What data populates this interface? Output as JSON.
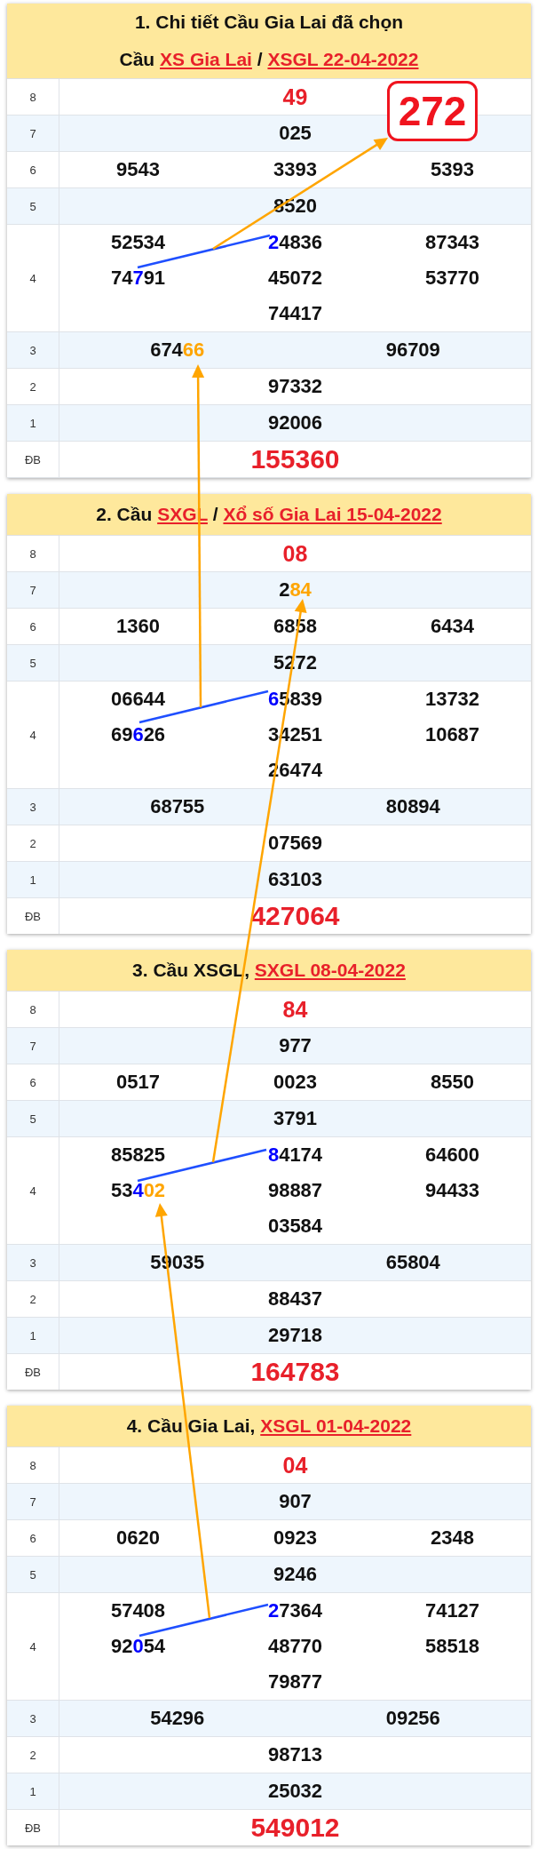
{
  "cards": [
    {
      "title_lines": [
        [
          {
            "text": "1. Chi tiết Cầu Gia Lai đã chọn"
          }
        ],
        [
          {
            "text": "Cầu "
          },
          {
            "text": "XS Gia Lai",
            "link": true
          },
          {
            "text": " / "
          },
          {
            "text": "XSGL 22-04-2022",
            "link": true
          }
        ]
      ],
      "badge": "272",
      "rows": [
        {
          "label": "8",
          "kind": "eighth",
          "values": [
            [
              {
                "text": "49"
              }
            ]
          ]
        },
        {
          "label": "7",
          "kind": "regular",
          "values": [
            [
              {
                "text": "025"
              }
            ]
          ]
        },
        {
          "label": "6",
          "kind": "regular",
          "values": [
            [
              {
                "text": "9543"
              }
            ],
            [
              {
                "text": "3393"
              }
            ],
            [
              {
                "text": "5393"
              }
            ]
          ]
        },
        {
          "label": "5",
          "kind": "regular",
          "values": [
            [
              {
                "text": "8520"
              }
            ]
          ]
        },
        {
          "label": "4",
          "kind": "regular",
          "values": [
            [
              {
                "text": "52534"
              }
            ],
            [
              {
                "text": "2",
                "color": "#0000ff"
              },
              {
                "text": "4836"
              }
            ],
            [
              {
                "text": "87343"
              }
            ],
            [
              {
                "text": "74"
              },
              {
                "text": "7",
                "color": "#0000ff"
              },
              {
                "text": "91"
              }
            ],
            [
              {
                "text": "45072"
              }
            ],
            [
              {
                "text": "53770"
              }
            ],
            [
              {
                "text": "74417"
              }
            ]
          ]
        },
        {
          "label": "3",
          "kind": "regular",
          "values": [
            [
              {
                "text": "674"
              },
              {
                "text": "66",
                "color": "#ffa500"
              }
            ],
            [
              {
                "text": "96709"
              }
            ]
          ]
        },
        {
          "label": "2",
          "kind": "regular",
          "values": [
            [
              {
                "text": "97332"
              }
            ]
          ]
        },
        {
          "label": "1",
          "kind": "regular",
          "values": [
            [
              {
                "text": "92006"
              }
            ]
          ]
        },
        {
          "label": "ĐB",
          "kind": "special",
          "values": [
            [
              {
                "text": "155360"
              }
            ]
          ]
        }
      ]
    },
    {
      "title_lines": [
        [
          {
            "text": "2. Cầu "
          },
          {
            "text": "SXGL",
            "link": true
          },
          {
            "text": " / "
          },
          {
            "text": "Xổ số Gia Lai 15-04-2022",
            "link": true
          }
        ]
      ],
      "rows": [
        {
          "label": "8",
          "kind": "eighth",
          "values": [
            [
              {
                "text": "08"
              }
            ]
          ]
        },
        {
          "label": "7",
          "kind": "regular",
          "values": [
            [
              {
                "text": "2"
              },
              {
                "text": "84",
                "color": "#ffa500"
              }
            ]
          ]
        },
        {
          "label": "6",
          "kind": "regular",
          "values": [
            [
              {
                "text": "1360"
              }
            ],
            [
              {
                "text": "6858"
              }
            ],
            [
              {
                "text": "6434"
              }
            ]
          ]
        },
        {
          "label": "5",
          "kind": "regular",
          "values": [
            [
              {
                "text": "5272"
              }
            ]
          ]
        },
        {
          "label": "4",
          "kind": "regular",
          "values": [
            [
              {
                "text": "06644"
              }
            ],
            [
              {
                "text": "6",
                "color": "#0000ff"
              },
              {
                "text": "5839"
              }
            ],
            [
              {
                "text": "13732"
              }
            ],
            [
              {
                "text": "69"
              },
              {
                "text": "6",
                "color": "#0000ff"
              },
              {
                "text": "26"
              }
            ],
            [
              {
                "text": "34251"
              }
            ],
            [
              {
                "text": "10687"
              }
            ],
            [
              {
                "text": "26474"
              }
            ]
          ]
        },
        {
          "label": "3",
          "kind": "regular",
          "values": [
            [
              {
                "text": "68755"
              }
            ],
            [
              {
                "text": "80894"
              }
            ]
          ]
        },
        {
          "label": "2",
          "kind": "regular",
          "values": [
            [
              {
                "text": "07569"
              }
            ]
          ]
        },
        {
          "label": "1",
          "kind": "regular",
          "values": [
            [
              {
                "text": "63103"
              }
            ]
          ]
        },
        {
          "label": "ĐB",
          "kind": "special",
          "values": [
            [
              {
                "text": "427064"
              }
            ]
          ]
        }
      ]
    },
    {
      "title_lines": [
        [
          {
            "text": "3. Cầu XSGL, "
          },
          {
            "text": "SXGL 08-04-2022",
            "link": true
          }
        ]
      ],
      "rows": [
        {
          "label": "8",
          "kind": "eighth",
          "values": [
            [
              {
                "text": "84"
              }
            ]
          ]
        },
        {
          "label": "7",
          "kind": "regular",
          "values": [
            [
              {
                "text": "977"
              }
            ]
          ]
        },
        {
          "label": "6",
          "kind": "regular",
          "values": [
            [
              {
                "text": "0517"
              }
            ],
            [
              {
                "text": "0023"
              }
            ],
            [
              {
                "text": "8550"
              }
            ]
          ]
        },
        {
          "label": "5",
          "kind": "regular",
          "values": [
            [
              {
                "text": "3791"
              }
            ]
          ]
        },
        {
          "label": "4",
          "kind": "regular",
          "values": [
            [
              {
                "text": "85825"
              }
            ],
            [
              {
                "text": "8",
                "color": "#0000ff"
              },
              {
                "text": "4174"
              }
            ],
            [
              {
                "text": "64600"
              }
            ],
            [
              {
                "text": "53"
              },
              {
                "text": "4",
                "color": "#0000ff"
              },
              {
                "text": "02",
                "color": "#ffa500"
              }
            ],
            [
              {
                "text": "98887"
              }
            ],
            [
              {
                "text": "94433"
              }
            ],
            [
              {
                "text": "03584"
              }
            ]
          ]
        },
        {
          "label": "3",
          "kind": "regular",
          "values": [
            [
              {
                "text": "59035"
              }
            ],
            [
              {
                "text": "65804"
              }
            ]
          ]
        },
        {
          "label": "2",
          "kind": "regular",
          "values": [
            [
              {
                "text": "88437"
              }
            ]
          ]
        },
        {
          "label": "1",
          "kind": "regular",
          "values": [
            [
              {
                "text": "29718"
              }
            ]
          ]
        },
        {
          "label": "ĐB",
          "kind": "special",
          "values": [
            [
              {
                "text": "164783"
              }
            ]
          ]
        }
      ]
    },
    {
      "title_lines": [
        [
          {
            "text": "4. Cầu Gia Lai, "
          },
          {
            "text": "XSGL 01-04-2022",
            "link": true
          }
        ]
      ],
      "rows": [
        {
          "label": "8",
          "kind": "eighth",
          "values": [
            [
              {
                "text": "04"
              }
            ]
          ]
        },
        {
          "label": "7",
          "kind": "regular",
          "values": [
            [
              {
                "text": "907"
              }
            ]
          ]
        },
        {
          "label": "6",
          "kind": "regular",
          "values": [
            [
              {
                "text": "0620"
              }
            ],
            [
              {
                "text": "0923"
              }
            ],
            [
              {
                "text": "2348"
              }
            ]
          ]
        },
        {
          "label": "5",
          "kind": "regular",
          "values": [
            [
              {
                "text": "9246"
              }
            ]
          ]
        },
        {
          "label": "4",
          "kind": "regular",
          "values": [
            [
              {
                "text": "57408"
              }
            ],
            [
              {
                "text": "2",
                "color": "#0000ff"
              },
              {
                "text": "7364"
              }
            ],
            [
              {
                "text": "74127"
              }
            ],
            [
              {
                "text": "92"
              },
              {
                "text": "0",
                "color": "#0000ff"
              },
              {
                "text": "54"
              }
            ],
            [
              {
                "text": "48770"
              }
            ],
            [
              {
                "text": "58518"
              }
            ],
            [
              {
                "text": "79877"
              }
            ]
          ]
        },
        {
          "label": "3",
          "kind": "regular",
          "values": [
            [
              {
                "text": "54296"
              }
            ],
            [
              {
                "text": "09256"
              }
            ]
          ]
        },
        {
          "label": "2",
          "kind": "regular",
          "values": [
            [
              {
                "text": "98713"
              }
            ]
          ]
        },
        {
          "label": "1",
          "kind": "regular",
          "values": [
            [
              {
                "text": "25032"
              }
            ]
          ]
        },
        {
          "label": "ĐB",
          "kind": "special",
          "values": [
            [
              {
                "text": "549012"
              }
            ]
          ]
        }
      ]
    }
  ]
}
